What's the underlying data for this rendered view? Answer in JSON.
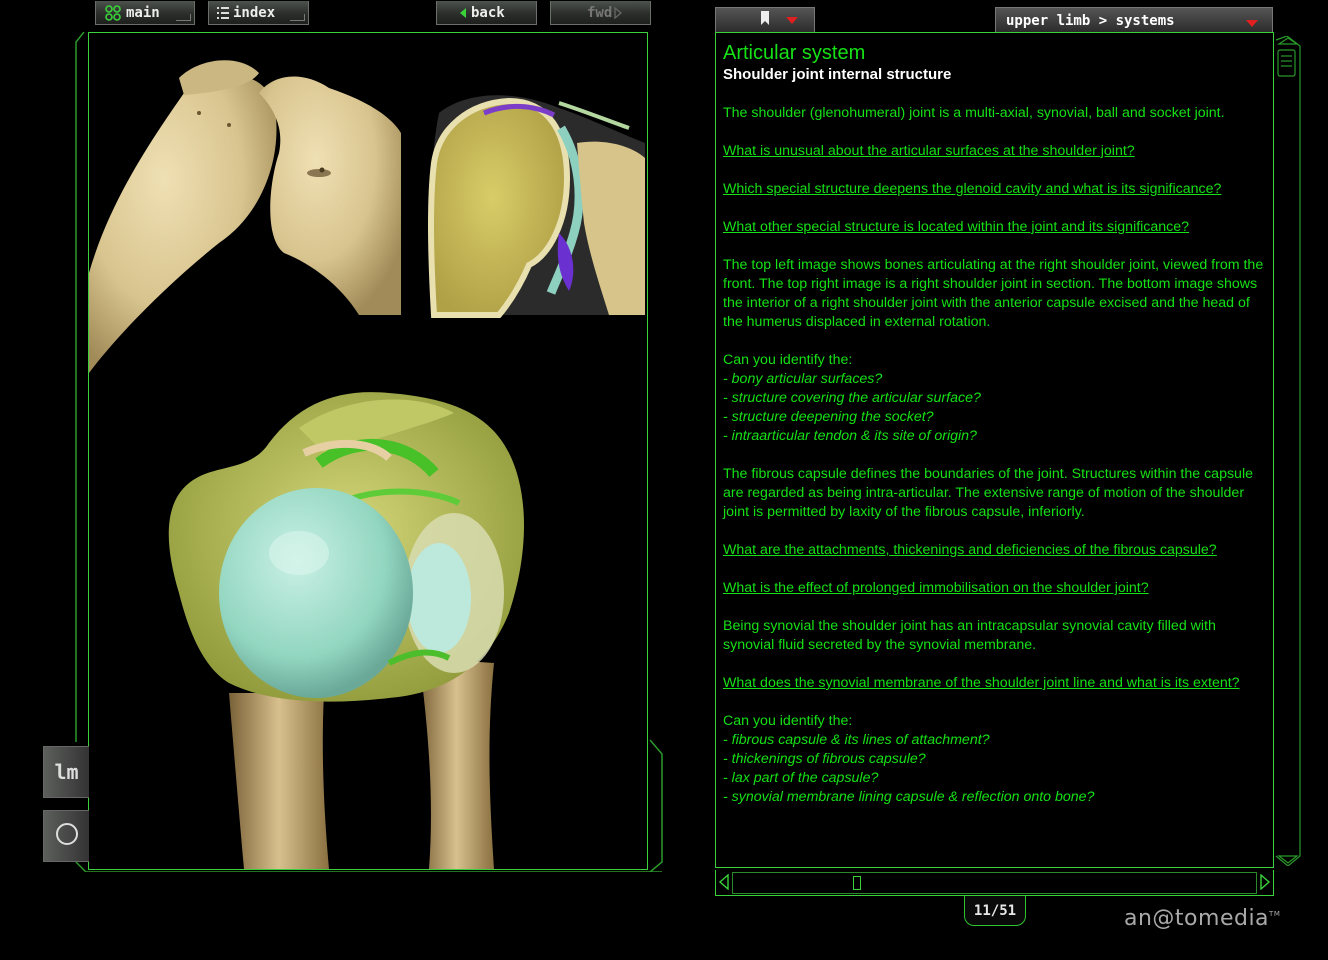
{
  "nav": {
    "main_label": "main",
    "index_label": "index",
    "back_label": "back",
    "fwd_label": "fwd"
  },
  "breadcrumb": "upper limb > systems",
  "side_tabs": [
    "lm",
    ""
  ],
  "content": {
    "title": "Articular system",
    "subtitle": "Shoulder joint internal structure",
    "intro": "The shoulder (glenohumeral) joint is a multi-axial, synovial, ball and socket joint.",
    "q1": "What is unusual about the articular surfaces at the shoulder joint?",
    "q2": "Which special structure deepens the glenoid cavity and what is its significance?",
    "q3": "What other special structure is located within the joint and its significance?",
    "description": "The top left image shows bones articulating at the right shoulder joint, viewed from the front. The top right image is a right shoulder joint in section. The bottom image shows the interior of a right shoulder joint with the anterior capsule excised and the head of the humerus displaced in external rotation.",
    "identify1_heading": "Can you identify the:",
    "identify1_items": [
      "- bony articular surfaces?",
      "- structure covering the articular surface?",
      "- structure deepening the socket?",
      "- intraarticular tendon & its site of origin?"
    ],
    "capsule_text": "The fibrous capsule defines the boundaries of the joint. Structures within the capsule are regarded as being intra-articular. The extensive range of motion of the shoulder joint is permitted by laxity of the fibrous capsule, inferiorly.",
    "q4": "What are the attachments, thickenings and deficiencies of the fibrous capsule?",
    "q5": "What is the effect of prolonged immobilisation on the shoulder joint?",
    "synovial_text": "Being synovial the shoulder joint has an intracapsular synovial cavity filled with synovial fluid secreted by the synovial membrane.",
    "q6": "What does the synovial membrane of the shoulder joint line and what is its extent?",
    "identify2_heading": "Can you identify the:",
    "identify2_items": [
      "- fibrous capsule & its lines of attachment?",
      "- thickenings of fibrous capsule?",
      "- lax part of the capsule?",
      "- synovial membrane lining capsule & reflection onto bone?"
    ]
  },
  "pager": "11/51",
  "brand": "an@tomedia",
  "brand_tm": "TM",
  "colors": {
    "accent_green": "#16e016",
    "frame_green": "#3bd13b",
    "background": "#000000",
    "dropdown_red": "#e02020"
  },
  "icons": [
    "main-nav-icon",
    "index-list-icon",
    "back-arrow-icon",
    "fwd-arrow-icon",
    "bookmark-icon",
    "dropdown-arrow-icon"
  ]
}
